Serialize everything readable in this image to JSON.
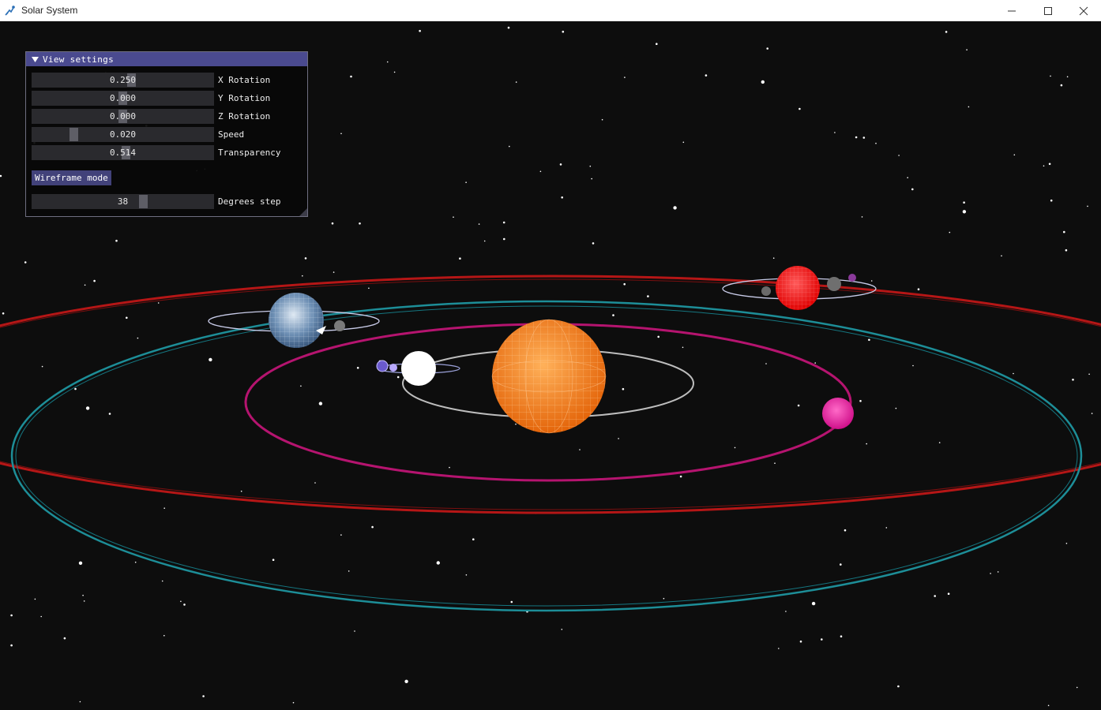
{
  "window": {
    "title": "Solar System",
    "controls": {
      "minimize_icon": "minimize-icon",
      "maximize_icon": "maximize-icon",
      "close_icon": "close-icon"
    }
  },
  "panel": {
    "title": "View settings",
    "collapse_icon": "triangle-down-icon",
    "sliders": [
      {
        "label": "X Rotation",
        "value_text": "0.250",
        "fraction": 0.55
      },
      {
        "label": "Y Rotation",
        "value_text": "0.000",
        "fraction": 0.5
      },
      {
        "label": "Z Rotation",
        "value_text": "0.000",
        "fraction": 0.5
      },
      {
        "label": "Speed",
        "value_text": "0.020",
        "fraction": 0.22
      },
      {
        "label": "Transparency",
        "value_text": "0.514",
        "fraction": 0.52
      }
    ],
    "wireframe_button": "Wireframe mode",
    "degrees": {
      "label": "Degrees step",
      "value_text": "38",
      "fraction": 0.62
    }
  },
  "colors": {
    "background": "#0d0d0d",
    "sun": "#ff8a1e",
    "orbit_inner": "#cfcfcf",
    "orbit_magenta": "#c0187a",
    "orbit_teal": "#1d8e98",
    "orbit_red": "#c01818",
    "planet_white": "#ffffff",
    "planet_magenta": "#e0209a",
    "planet_blue": "#8fb2d6",
    "planet_red": "#ff1a1a"
  }
}
